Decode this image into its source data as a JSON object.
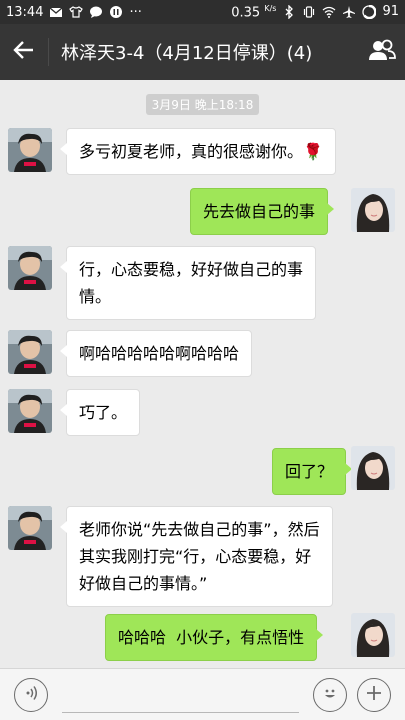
{
  "status_bar": {
    "time": "13:44",
    "speed": "0.35",
    "speed_unit": "K/s",
    "battery": "91",
    "more": "···"
  },
  "header": {
    "title": "林泽天3-4（4月12日停课）(4)"
  },
  "chat": {
    "timestamp": "3月9日 晚上18:18",
    "messages": [
      {
        "side": "left",
        "text": "多亏初夏老师，真的很感谢你。",
        "emoji": "rose"
      },
      {
        "side": "right",
        "text": "先去做自己的事"
      },
      {
        "side": "left",
        "text_lines": [
          "行，心态要稳，好好做自己的事",
          "情。"
        ]
      },
      {
        "side": "left",
        "text": "啊哈哈哈哈哈啊哈哈哈"
      },
      {
        "side": "left",
        "text": "巧了。"
      },
      {
        "side": "right",
        "text": "回了？"
      },
      {
        "side": "left",
        "text_lines": [
          "老师你说“先去做自己的事”，然后",
          "其实我刚打完“行，心态要稳，好",
          "好做自己的事情。”"
        ]
      },
      {
        "side": "right",
        "text": "哈哈哈  小伙子，有点悟性"
      }
    ]
  },
  "colors": {
    "title_bar": "#363636",
    "status_bar": "#2e2e2e",
    "chat_bg": "#ebebeb",
    "right_bubble": "#9fe658",
    "left_bubble": "#ffffff"
  },
  "icons": {
    "back": "arrow-left-icon",
    "members": "group-members-icon",
    "voice": "voice-icon",
    "emoji": "emoji-icon",
    "plus": "plus-icon"
  }
}
